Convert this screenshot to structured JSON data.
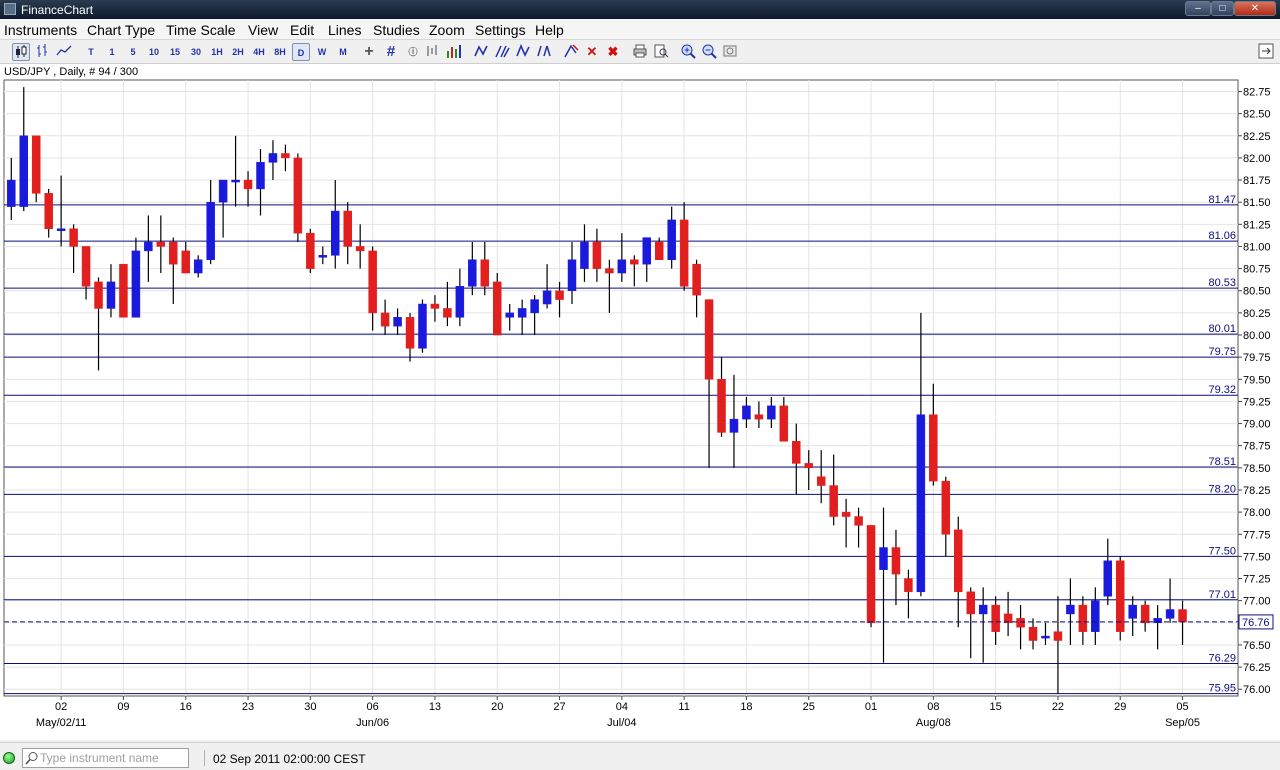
{
  "window": {
    "title": "FinanceChart",
    "controls": [
      "minimize",
      "maximize",
      "close"
    ]
  },
  "menu": [
    "Instruments",
    "Chart Type",
    "Time Scale",
    "View",
    "Edit",
    "Lines",
    "Studies",
    "Zoom",
    "Settings",
    "Help"
  ],
  "toolbar": {
    "timeframes": [
      "T",
      "1",
      "5",
      "10",
      "15",
      "30",
      "1H",
      "2H",
      "4H",
      "8H",
      "D",
      "W",
      "M"
    ],
    "selected_timeframe": "D"
  },
  "chart_header": "USD/JPY , Daily, # 94 / 300",
  "status": {
    "instrument_placeholder": "Type instrument name",
    "datetime": "02 Sep 2011 02:00:00 CEST"
  },
  "colors": {
    "up_candle": "#1a1adc",
    "down_candle": "#e21f1f",
    "level_line": "#0b0f7d",
    "grid": "#e4e4e4"
  },
  "chart_data": {
    "type": "candlestick",
    "symbol": "USD/JPY",
    "timeframe": "Daily",
    "ylim": [
      75.9,
      82.85
    ],
    "y_ticks": [
      "82.75",
      "82.50",
      "82.25",
      "82.00",
      "81.75",
      "81.50",
      "81.25",
      "81.00",
      "80.75",
      "80.50",
      "80.25",
      "80.00",
      "79.75",
      "79.50",
      "79.25",
      "79.00",
      "78.75",
      "78.50",
      "78.25",
      "78.00",
      "77.75",
      "77.50",
      "77.25",
      "77.00",
      "76.75",
      "76.50",
      "76.25",
      "76.00"
    ],
    "x_ticks": [
      "02",
      "09",
      "16",
      "23",
      "30",
      "06",
      "13",
      "20",
      "27",
      "04",
      "11",
      "18",
      "25",
      "01",
      "08",
      "15",
      "22",
      "29",
      "05"
    ],
    "month_labels": [
      {
        "label": "May/02/11",
        "at": "02"
      },
      {
        "label": "Jun/06",
        "at": "06"
      },
      {
        "label": "Jul/04",
        "at": "04"
      },
      {
        "label": "Aug/08",
        "at": "08"
      },
      {
        "label": "Sep/05",
        "at": "05"
      }
    ],
    "horizontal_levels": [
      81.47,
      81.06,
      80.53,
      80.01,
      79.75,
      79.32,
      78.51,
      78.2,
      77.5,
      77.01,
      76.29,
      75.95
    ],
    "current_price": 76.76,
    "grid": true,
    "candles": [
      {
        "o": 81.45,
        "h": 82.0,
        "l": 81.3,
        "c": 81.75
      },
      {
        "o": 81.45,
        "h": 82.8,
        "l": 81.4,
        "c": 82.25
      },
      {
        "o": 82.25,
        "h": 82.25,
        "l": 81.5,
        "c": 81.6
      },
      {
        "o": 81.6,
        "h": 81.65,
        "l": 81.1,
        "c": 81.2
      },
      {
        "o": 81.2,
        "h": 81.8,
        "l": 81.0,
        "c": 81.2
      },
      {
        "o": 81.2,
        "h": 81.25,
        "l": 80.7,
        "c": 81.0
      },
      {
        "o": 81.0,
        "h": 81.0,
        "l": 80.4,
        "c": 80.55
      },
      {
        "o": 80.6,
        "h": 80.65,
        "l": 79.6,
        "c": 80.3
      },
      {
        "o": 80.3,
        "h": 80.8,
        "l": 80.2,
        "c": 80.6
      },
      {
        "o": 80.8,
        "h": 80.8,
        "l": 80.2,
        "c": 80.2
      },
      {
        "o": 80.2,
        "h": 81.1,
        "l": 80.2,
        "c": 80.95
      },
      {
        "o": 80.95,
        "h": 81.35,
        "l": 80.6,
        "c": 81.05
      },
      {
        "o": 81.05,
        "h": 81.35,
        "l": 80.7,
        "c": 81.0
      },
      {
        "o": 81.05,
        "h": 81.1,
        "l": 80.35,
        "c": 80.8
      },
      {
        "o": 80.95,
        "h": 81.05,
        "l": 80.7,
        "c": 80.7
      },
      {
        "o": 80.7,
        "h": 80.9,
        "l": 80.65,
        "c": 80.85
      },
      {
        "o": 80.85,
        "h": 81.75,
        "l": 80.8,
        "c": 81.5
      },
      {
        "o": 81.5,
        "h": 81.75,
        "l": 81.1,
        "c": 81.75
      },
      {
        "o": 81.75,
        "h": 82.25,
        "l": 81.45,
        "c": 81.75
      },
      {
        "o": 81.75,
        "h": 81.85,
        "l": 81.45,
        "c": 81.65
      },
      {
        "o": 81.65,
        "h": 82.1,
        "l": 81.35,
        "c": 81.95
      },
      {
        "o": 81.95,
        "h": 82.2,
        "l": 81.75,
        "c": 82.05
      },
      {
        "o": 82.05,
        "h": 82.15,
        "l": 81.85,
        "c": 82.0
      },
      {
        "o": 82.0,
        "h": 82.05,
        "l": 81.05,
        "c": 81.15
      },
      {
        "o": 81.15,
        "h": 81.2,
        "l": 80.7,
        "c": 80.75
      },
      {
        "o": 80.9,
        "h": 81.0,
        "l": 80.8,
        "c": 80.9
      },
      {
        "o": 80.9,
        "h": 81.75,
        "l": 80.75,
        "c": 81.4
      },
      {
        "o": 81.4,
        "h": 81.5,
        "l": 80.8,
        "c": 81.0
      },
      {
        "o": 81.0,
        "h": 81.25,
        "l": 80.75,
        "c": 80.95
      },
      {
        "o": 80.95,
        "h": 81.0,
        "l": 80.05,
        "c": 80.25
      },
      {
        "o": 80.25,
        "h": 80.4,
        "l": 80.0,
        "c": 80.1
      },
      {
        "o": 80.1,
        "h": 80.3,
        "l": 80.0,
        "c": 80.2
      },
      {
        "o": 80.2,
        "h": 80.25,
        "l": 79.7,
        "c": 79.85
      },
      {
        "o": 79.85,
        "h": 80.4,
        "l": 79.8,
        "c": 80.35
      },
      {
        "o": 80.35,
        "h": 80.45,
        "l": 80.15,
        "c": 80.3
      },
      {
        "o": 80.3,
        "h": 80.6,
        "l": 80.1,
        "c": 80.2
      },
      {
        "o": 80.2,
        "h": 80.75,
        "l": 80.1,
        "c": 80.55
      },
      {
        "o": 80.55,
        "h": 81.05,
        "l": 80.45,
        "c": 80.85
      },
      {
        "o": 80.85,
        "h": 81.05,
        "l": 80.45,
        "c": 80.55
      },
      {
        "o": 80.6,
        "h": 80.7,
        "l": 80.0,
        "c": 80.0
      },
      {
        "o": 80.2,
        "h": 80.35,
        "l": 80.05,
        "c": 80.25
      },
      {
        "o": 80.2,
        "h": 80.4,
        "l": 80.0,
        "c": 80.3
      },
      {
        "o": 80.25,
        "h": 80.45,
        "l": 80.0,
        "c": 80.4
      },
      {
        "o": 80.35,
        "h": 80.8,
        "l": 80.3,
        "c": 80.5
      },
      {
        "o": 80.5,
        "h": 80.6,
        "l": 80.2,
        "c": 80.4
      },
      {
        "o": 80.5,
        "h": 81.05,
        "l": 80.35,
        "c": 80.85
      },
      {
        "o": 80.75,
        "h": 81.25,
        "l": 80.6,
        "c": 81.05
      },
      {
        "o": 81.05,
        "h": 81.2,
        "l": 80.6,
        "c": 80.75
      },
      {
        "o": 80.75,
        "h": 80.85,
        "l": 80.25,
        "c": 80.7
      },
      {
        "o": 80.7,
        "h": 81.15,
        "l": 80.6,
        "c": 80.85
      },
      {
        "o": 80.85,
        "h": 80.9,
        "l": 80.55,
        "c": 80.8
      },
      {
        "o": 80.8,
        "h": 81.1,
        "l": 80.6,
        "c": 81.1
      },
      {
        "o": 81.05,
        "h": 81.1,
        "l": 80.85,
        "c": 80.85
      },
      {
        "o": 80.85,
        "h": 81.45,
        "l": 80.75,
        "c": 81.3
      },
      {
        "o": 81.3,
        "h": 81.5,
        "l": 80.5,
        "c": 80.55
      },
      {
        "o": 80.8,
        "h": 80.85,
        "l": 80.2,
        "c": 80.45
      },
      {
        "o": 80.4,
        "h": 80.4,
        "l": 78.5,
        "c": 79.5
      },
      {
        "o": 79.5,
        "h": 79.75,
        "l": 78.85,
        "c": 78.9
      },
      {
        "o": 78.9,
        "h": 79.55,
        "l": 78.5,
        "c": 79.05
      },
      {
        "o": 79.05,
        "h": 79.3,
        "l": 78.95,
        "c": 79.2
      },
      {
        "o": 79.1,
        "h": 79.25,
        "l": 78.95,
        "c": 79.05
      },
      {
        "o": 79.05,
        "h": 79.3,
        "l": 78.95,
        "c": 79.2
      },
      {
        "o": 79.2,
        "h": 79.3,
        "l": 78.8,
        "c": 78.8
      },
      {
        "o": 78.8,
        "h": 79.0,
        "l": 78.2,
        "c": 78.55
      },
      {
        "o": 78.55,
        "h": 78.7,
        "l": 78.25,
        "c": 78.5
      },
      {
        "o": 78.4,
        "h": 78.7,
        "l": 78.1,
        "c": 78.3
      },
      {
        "o": 78.3,
        "h": 78.65,
        "l": 77.85,
        "c": 77.95
      },
      {
        "o": 78.0,
        "h": 78.15,
        "l": 77.6,
        "c": 77.95
      },
      {
        "o": 77.95,
        "h": 78.05,
        "l": 77.6,
        "c": 77.85
      },
      {
        "o": 77.85,
        "h": 77.85,
        "l": 76.7,
        "c": 76.75
      },
      {
        "o": 77.35,
        "h": 78.05,
        "l": 76.3,
        "c": 77.6
      },
      {
        "o": 77.6,
        "h": 77.8,
        "l": 76.95,
        "c": 77.3
      },
      {
        "o": 77.25,
        "h": 77.35,
        "l": 76.8,
        "c": 77.1
      },
      {
        "o": 77.1,
        "h": 80.25,
        "l": 77.05,
        "c": 79.1
      },
      {
        "o": 79.1,
        "h": 79.45,
        "l": 78.3,
        "c": 78.35
      },
      {
        "o": 78.35,
        "h": 78.4,
        "l": 77.5,
        "c": 77.75
      },
      {
        "o": 77.8,
        "h": 77.95,
        "l": 76.7,
        "c": 77.1
      },
      {
        "o": 77.1,
        "h": 77.15,
        "l": 76.35,
        "c": 76.85
      },
      {
        "o": 76.85,
        "h": 77.15,
        "l": 76.3,
        "c": 76.95
      },
      {
        "o": 76.95,
        "h": 77.05,
        "l": 76.5,
        "c": 76.65
      },
      {
        "o": 76.85,
        "h": 77.1,
        "l": 76.6,
        "c": 76.75
      },
      {
        "o": 76.8,
        "h": 76.95,
        "l": 76.45,
        "c": 76.7
      },
      {
        "o": 76.7,
        "h": 76.8,
        "l": 76.45,
        "c": 76.55
      },
      {
        "o": 76.6,
        "h": 76.75,
        "l": 76.5,
        "c": 76.6
      },
      {
        "o": 76.65,
        "h": 77.05,
        "l": 75.95,
        "c": 76.55
      },
      {
        "o": 76.85,
        "h": 77.25,
        "l": 76.5,
        "c": 76.95
      },
      {
        "o": 76.95,
        "h": 77.05,
        "l": 76.5,
        "c": 76.65
      },
      {
        "o": 76.65,
        "h": 77.15,
        "l": 76.5,
        "c": 77.0
      },
      {
        "o": 77.05,
        "h": 77.7,
        "l": 76.95,
        "c": 77.45
      },
      {
        "o": 77.45,
        "h": 77.5,
        "l": 76.55,
        "c": 76.65
      },
      {
        "o": 76.8,
        "h": 77.05,
        "l": 76.6,
        "c": 76.95
      },
      {
        "o": 76.95,
        "h": 77.0,
        "l": 76.65,
        "c": 76.75
      },
      {
        "o": 76.75,
        "h": 76.95,
        "l": 76.45,
        "c": 76.8
      },
      {
        "o": 76.8,
        "h": 77.25,
        "l": 76.75,
        "c": 76.9
      },
      {
        "o": 76.9,
        "h": 77.0,
        "l": 76.5,
        "c": 76.76
      }
    ]
  }
}
